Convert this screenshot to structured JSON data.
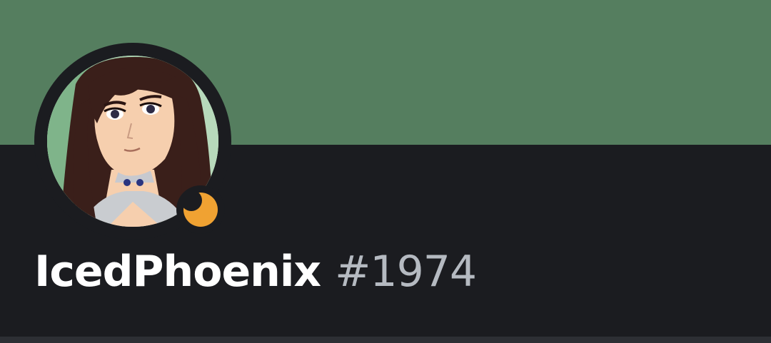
{
  "profile": {
    "username": "IcedPhoenix",
    "discriminator": "#1974",
    "avatar_icon": "anime-character-avatar",
    "status_icon": "idle-moon-icon"
  },
  "colors": {
    "banner": "#557e5f",
    "background": "#1b1c20",
    "status_idle": "#f0a232",
    "discriminator": "#b5bac1"
  }
}
